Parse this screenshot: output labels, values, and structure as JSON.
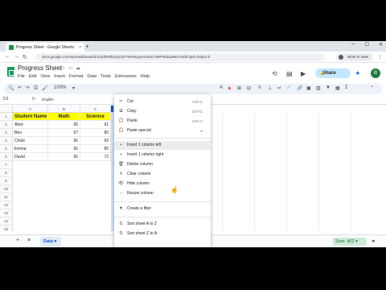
{
  "browser": {
    "tab_title": "Progress Sheet - Google Sheets",
    "tab_close": "×",
    "new_tab": "+",
    "url": "docs.google.com/spreadsheets/d/1rtjdDMhkcty1Sb7Wn9UpyXcNx4CN9PWduptNDA/edit?gid=0#gid=0",
    "profile_label": "Work in view",
    "window_controls": [
      "─",
      "☐",
      "✕"
    ]
  },
  "sheets": {
    "doc_title": "Progress Sheet",
    "menus": [
      "File",
      "Edit",
      "View",
      "Insert",
      "Format",
      "Data",
      "Tools",
      "Extensions",
      "Help"
    ],
    "share_label": "Share",
    "user_initial": "B",
    "zoom": "100%",
    "name_box": "D3",
    "formula_value": "English"
  },
  "grid": {
    "columns": [
      "A",
      "B",
      "C",
      "D"
    ],
    "rows": [
      "1",
      "2",
      "3",
      "4",
      "5",
      "6",
      "7",
      "8",
      "9",
      "10",
      "11",
      "12",
      "13",
      "14",
      "15"
    ],
    "headers": [
      "Student Name",
      "Math",
      "Science"
    ],
    "data": [
      {
        "name": "Alice",
        "math": "66",
        "sci": "91"
      },
      {
        "name": "Ben",
        "math": "67",
        "sci": "80"
      },
      {
        "name": "Chole",
        "math": "66",
        "sci": "92"
      },
      {
        "name": "Emma",
        "math": "65",
        "sci": "85"
      },
      {
        "name": "David",
        "math": "65",
        "sci": "72"
      }
    ]
  },
  "context_menu": {
    "items": [
      {
        "icon": "✂",
        "label": "Cut",
        "shortcut": "Ctrl+X"
      },
      {
        "icon": "⧉",
        "label": "Copy",
        "shortcut": "Ctrl+C"
      },
      {
        "icon": "📋",
        "label": "Paste",
        "shortcut": "Ctrl+V"
      },
      {
        "icon": "📋",
        "label": "Paste special",
        "shortcut": "▸"
      },
      {
        "icon": "+",
        "label": "Insert 1 column left",
        "shortcut": ""
      },
      {
        "icon": "+",
        "label": "Insert 1 column right",
        "shortcut": ""
      },
      {
        "icon": "🗑",
        "label": "Delete column",
        "shortcut": ""
      },
      {
        "icon": "✕",
        "label": "Clear column",
        "shortcut": ""
      },
      {
        "icon": "👁",
        "label": "Hide column",
        "shortcut": ""
      },
      {
        "icon": "⇔",
        "label": "Resize column",
        "shortcut": ""
      },
      {
        "icon": "▼",
        "label": "Create a filter",
        "shortcut": ""
      },
      {
        "icon": "⇅",
        "label": "Sort sheet A to Z",
        "shortcut": ""
      },
      {
        "icon": "⇅",
        "label": "Sort sheet Z to A",
        "shortcut": ""
      }
    ]
  },
  "bottom": {
    "sheet_tab": "Data",
    "sum_label": "Sum: 402"
  },
  "colors": {
    "header_fill": "#ffff00",
    "selected_column": "#d3e3fd",
    "share_button": "#c2e7ff"
  }
}
